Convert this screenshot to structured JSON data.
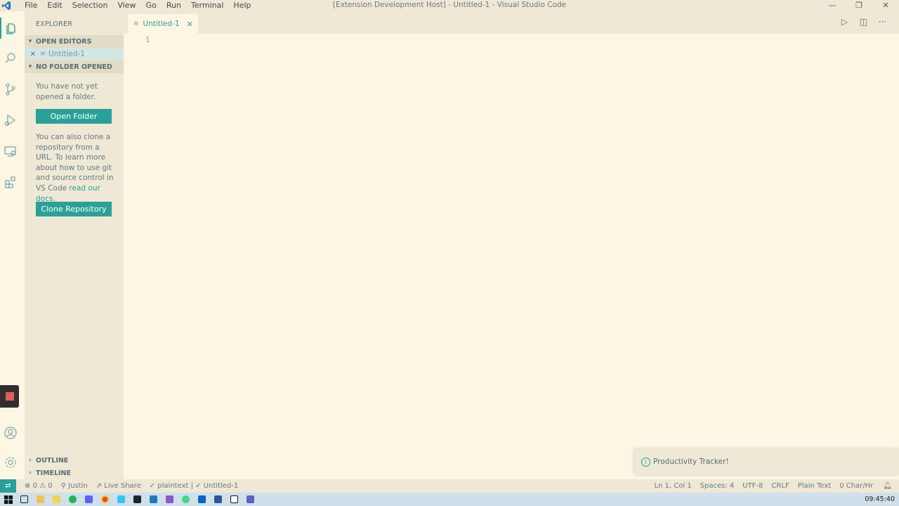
{
  "titlebar": {
    "window_title": "[Extension Development Host] - Untitled-1 - Visual Studio Code",
    "menu": [
      "File",
      "Edit",
      "Selection",
      "View",
      "Go",
      "Run",
      "Terminal",
      "Help"
    ],
    "minimize": "—",
    "restore": "❐",
    "close": "✕"
  },
  "activity": {
    "icons": [
      "explorer-icon",
      "search-icon",
      "source-control-icon",
      "run-debug-icon",
      "remote-explorer-icon",
      "extensions-icon",
      "stop-icon",
      "account-icon",
      "settings-gear-icon"
    ],
    "accent_color": "#2aa198"
  },
  "sidebar": {
    "title": "EXPLORER",
    "open_editors": "OPEN EDITORS",
    "open_file": "Untitled-1",
    "no_folder": "NO FOLDER OPENED",
    "no_folder_text": "You have not yet opened a folder.",
    "open_folder_button": "Open Folder",
    "clone_text_before": "You can also clone a repository from a URL. To learn more about how to use git and source control in VS Code ",
    "clone_link": "read our docs",
    "clone_text_after": ".",
    "clone_button": "Clone Repository",
    "outline": "OUTLINE",
    "timeline": "TIMELINE"
  },
  "editor": {
    "tab_label": "Untitled-1",
    "line_number": "1"
  },
  "notification": {
    "message": "Productivity Tracker!"
  },
  "statusbar": {
    "errors": "0",
    "warnings": "0",
    "user": "Justin",
    "live_share": "Live Share",
    "language_info": "plaintext | ✓ Untitled-1",
    "cursor": "Ln 1, Col 1",
    "spaces": "Spaces: 4",
    "encoding": "UTF-8",
    "eol": "CRLF",
    "language": "Plain Text",
    "char_rate": "0 Char/Hr"
  },
  "taskbar": {
    "clock": "09:45:40",
    "apps": [
      "windows-start-icon",
      "task-view-icon",
      "file-explorer-icon",
      "sticky-notes-icon",
      "spotify-icon",
      "discord-icon",
      "chrome-icon",
      "slack-icon",
      "terminal-icon",
      "vscode-icon",
      "visual-studio-icon",
      "android-studio-icon",
      "outlook-icon",
      "word-icon",
      "notion-icon",
      "teams-icon"
    ]
  }
}
